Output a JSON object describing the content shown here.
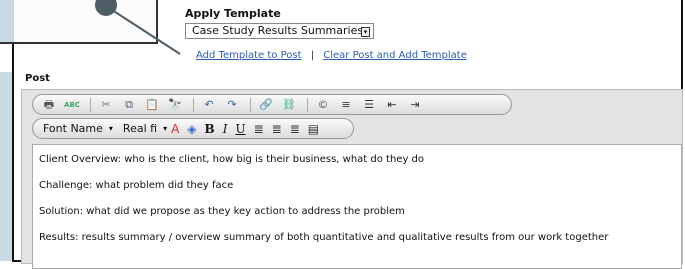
{
  "template": {
    "label": "Apply Template",
    "selected": "Case Study Results Summaries",
    "add_link": "Add Template to Post",
    "separator": "|",
    "clear_link": "Clear Post and Add Template"
  },
  "post": {
    "label": "Post"
  },
  "toolbar": {
    "row1": [
      {
        "name": "print-icon",
        "glyph": "🖶",
        "color": "#555"
      },
      {
        "name": "spellcheck-icon",
        "glyph": "ABC",
        "color": "#3a6"
      },
      {
        "name": "cut-icon",
        "glyph": "✂",
        "color": "#777"
      },
      {
        "name": "copy-icon",
        "glyph": "⧉",
        "color": "#557"
      },
      {
        "name": "paste-icon",
        "glyph": "📋",
        "color": "#a66"
      },
      {
        "name": "find-icon",
        "glyph": "🔭",
        "color": "#555"
      },
      {
        "name": "undo-icon",
        "glyph": "↶",
        "color": "#36a"
      },
      {
        "name": "redo-icon",
        "glyph": "↷",
        "color": "#36a"
      },
      {
        "name": "insert-link-icon",
        "glyph": "🔗",
        "color": "#2a8"
      },
      {
        "name": "unlink-icon",
        "glyph": "⛓",
        "color": "#2a8"
      },
      {
        "name": "insert-special-icon",
        "glyph": "©",
        "color": "#555"
      },
      {
        "name": "ordered-list-icon",
        "glyph": "≡",
        "color": "#333"
      },
      {
        "name": "bullet-list-icon",
        "glyph": "☰",
        "color": "#333"
      },
      {
        "name": "outdent-icon",
        "glyph": "⇤",
        "color": "#333"
      },
      {
        "name": "indent-icon",
        "glyph": "⇥",
        "color": "#333"
      }
    ],
    "font_name": "Font Name",
    "font_size": "Real fi",
    "row2": [
      {
        "name": "text-color-icon",
        "glyph": "A",
        "color": "#c33"
      },
      {
        "name": "highlight-color-icon",
        "glyph": "◈",
        "color": "#36c"
      },
      {
        "name": "bold-icon",
        "glyph": "B",
        "color": "#111"
      },
      {
        "name": "italic-icon",
        "glyph": "I",
        "color": "#111"
      },
      {
        "name": "underline-icon",
        "glyph": "U",
        "color": "#111"
      },
      {
        "name": "align-left-icon",
        "glyph": "≣",
        "color": "#333"
      },
      {
        "name": "align-center-icon",
        "glyph": "≣",
        "color": "#333"
      },
      {
        "name": "align-right-icon",
        "glyph": "≣",
        "color": "#333"
      },
      {
        "name": "align-justify-icon",
        "glyph": "▤",
        "color": "#333"
      }
    ]
  },
  "content": {
    "lines": [
      "Client Overview: who is the client, how big is their business, what do they do",
      "Challenge:  what problem did they face",
      "Solution:  what did we propose as they key action to address the problem",
      "Results:  results summary / overview summary of both quantitative and qualitative results from our work together"
    ]
  }
}
